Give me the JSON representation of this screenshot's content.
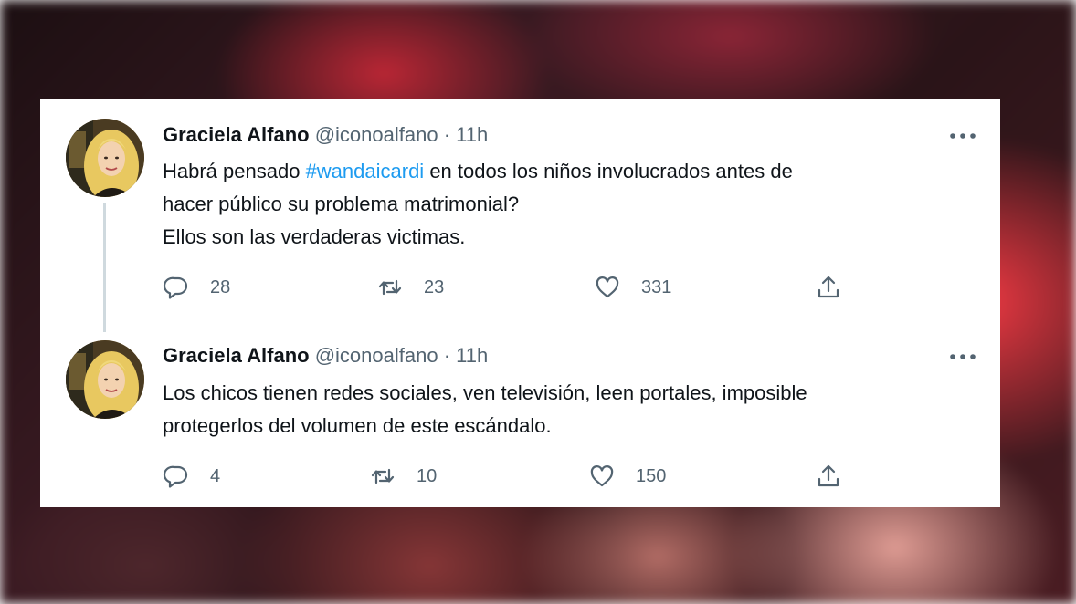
{
  "tweets": [
    {
      "author": {
        "name": "Graciela Alfano",
        "handle": "@iconoalfano",
        "separator": "·",
        "time": "11h"
      },
      "text": {
        "line1_before": "Habrá pensado ",
        "line1_hashtag": "#wandaicardi",
        "line1_after": " en todos los niños involucrados antes de",
        "line2": "hacer público su problema matrimonial?",
        "line3": "Ellos son las verdaderas victimas."
      },
      "metrics": {
        "replies": "28",
        "retweets": "23",
        "likes": "331"
      }
    },
    {
      "author": {
        "name": "Graciela Alfano",
        "handle": "@iconoalfano",
        "separator": "·",
        "time": "11h"
      },
      "text": {
        "line1": "Los chicos tienen redes sociales, ven televisión, leen portales, imposible",
        "line2": "protegerlos del volumen de este escándalo."
      },
      "metrics": {
        "replies": "4",
        "retweets": "10",
        "likes": "150"
      }
    }
  ],
  "icons": {
    "more": "more-horizontal-icon",
    "reply": "reply-bubble-icon",
    "retweet": "retweet-arrows-icon",
    "like": "heart-outline-icon",
    "share": "share-upload-icon"
  },
  "colors": {
    "text": "#0f1419",
    "secondary": "#536471",
    "hashtag": "#1d9bf0",
    "thread_line": "#cfd9de",
    "card": "#ffffff"
  }
}
